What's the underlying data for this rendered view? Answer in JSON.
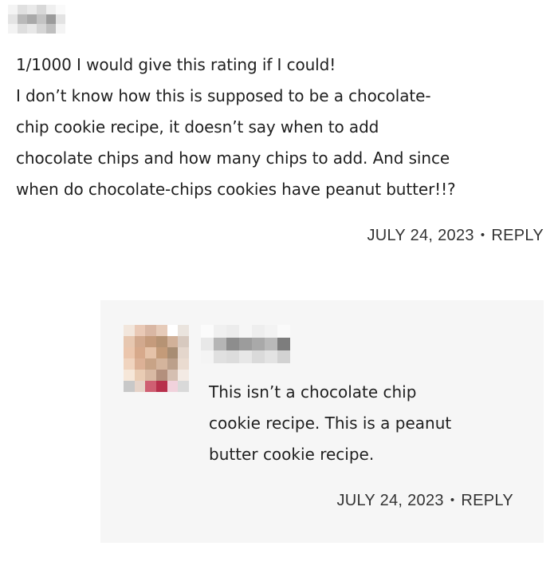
{
  "comment": {
    "text_lines": [
      "1/1000 I would give this rating if I could!",
      "I don’t know how this is supposed to be a chocolate-",
      "chip cookie recipe, it doesn’t say when to add",
      "chocolate chips and how many chips to add. And since",
      "when do chocolate-chips cookies have peanut butter!!?"
    ],
    "date": "JULY 24, 2023",
    "separator": "•",
    "reply_label": "REPLY"
  },
  "reply": {
    "text_lines": [
      "This isn’t a chocolate chip",
      "cookie recipe. This is a peanut",
      "butter cookie recipe."
    ],
    "date": "JULY 24, 2023",
    "separator": "•",
    "reply_label": "REPLY"
  },
  "colors": {
    "text": "#1f1f1f",
    "meta_text": "#333333",
    "reply_background": "#f6f6f6"
  },
  "pixelated": {
    "top_name": [
      "#f4f4f4",
      "#e0e0e0",
      "#e9e9e9",
      "#d8d8d8",
      "#efefef",
      "#fafafa",
      "#e4e4e4",
      "#b9b9b9",
      "#a9a9a9",
      "#c3c3c3",
      "#9b9b9b",
      "#e3e3e3",
      "#f3f3f3",
      "#dedede",
      "#e8e8e8",
      "#d5d5d5",
      "#bfbfbf",
      "#f4f4f4"
    ],
    "avatar": [
      "#f2e6dc",
      "#e9c9b6",
      "#d9b7a4",
      "#e6cbb9",
      "#ffffff",
      "#eae4de",
      "#e7c7b0",
      "#d2a98e",
      "#c59b7c",
      "#b69374",
      "#d1b199",
      "#d7c9bf",
      "#ebc6ad",
      "#d7a98b",
      "#e5c2a8",
      "#c49b79",
      "#a88d73",
      "#e4d6cc",
      "#f0d4bf",
      "#dcb196",
      "#c8a386",
      "#d4b49c",
      "#bca08b",
      "#eadbd0",
      "#f6e7d9",
      "#e9ccb4",
      "#d8b9a3",
      "#b3907d",
      "#d5bfb1",
      "#f3eae4",
      "#c8c8c8",
      "#e6d3c8",
      "#cf5f72",
      "#b8304c",
      "#f1d2dc",
      "#d9d9d9"
    ],
    "reply_name": [
      "#fbfbfb",
      "#f0f0f0",
      "#ececec",
      "#f6f6f6",
      "#eeeeee",
      "#f3f3f3",
      "#fafafa",
      "#e8e8e8",
      "#b5b5b5",
      "#8d8d8d",
      "#9c9c9c",
      "#a9a9a9",
      "#b9b9b9",
      "#7d7d7d",
      "#f4f4f4",
      "#e0e0e0",
      "#dcdcdc",
      "#e7e7e7",
      "#dadada",
      "#e3e3e3",
      "#d2d2d2"
    ]
  }
}
